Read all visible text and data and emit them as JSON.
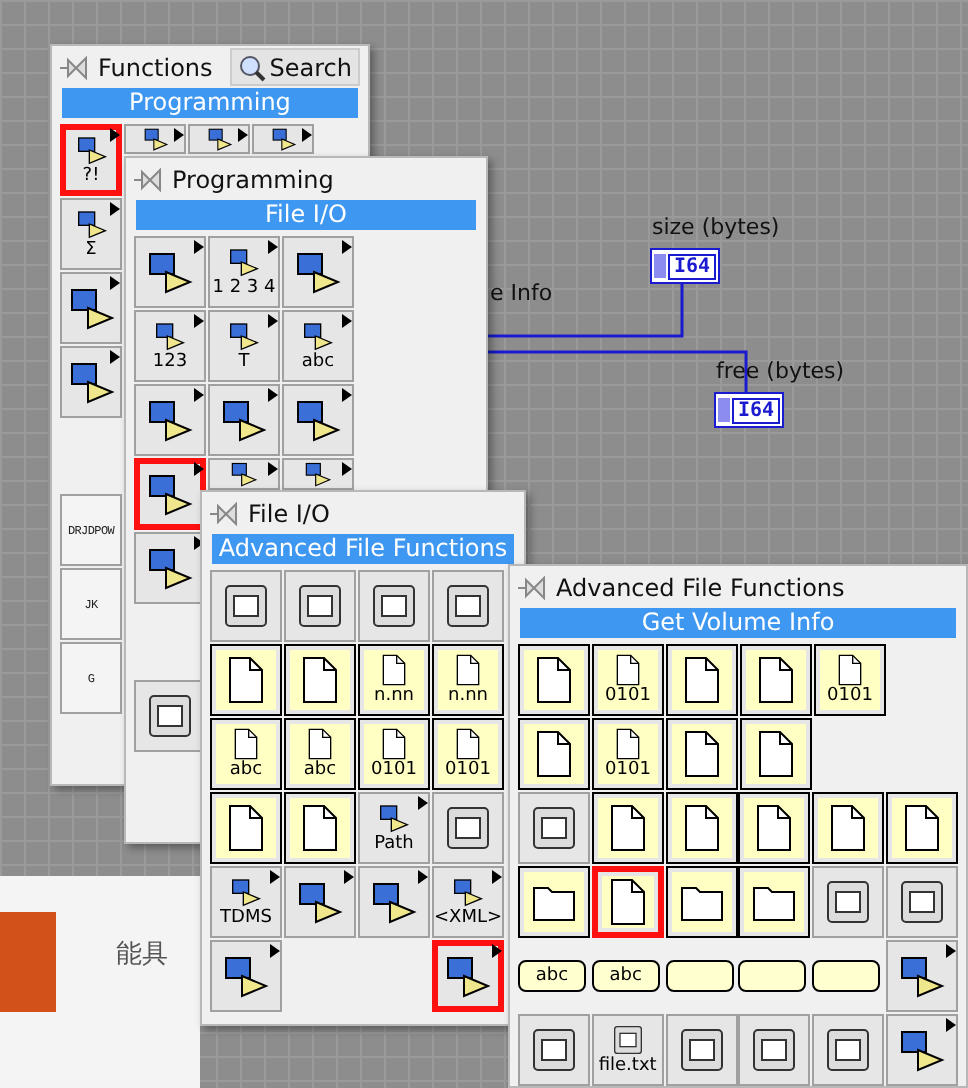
{
  "diagram": {
    "node_label": "e Info",
    "indicators": [
      {
        "label": "size (bytes)",
        "type": "I64"
      },
      {
        "label": "free (bytes)",
        "type": "I64"
      }
    ]
  },
  "page_text": "能具",
  "palettes": [
    {
      "title": "Functions",
      "search": "Search",
      "header": "Programming",
      "rows": [
        [
          {
            "kind": "palette",
            "label": "?!",
            "highlighted": true
          },
          {
            "kind": "palette",
            "highlighted": false
          },
          {
            "kind": "palette",
            "highlighted": false
          },
          {
            "kind": "palette",
            "highlighted": false
          }
        ],
        [
          {
            "kind": "palette",
            "label": "Σ",
            "highlighted": false
          }
        ],
        [
          {
            "kind": "palette",
            "highlighted": false
          }
        ],
        [
          {
            "kind": "palette",
            "highlighted": false
          }
        ],
        [
          {
            "kind": "empty"
          }
        ],
        [
          {
            "kind": "text",
            "label": "DRJDPOW",
            "highlighted": false
          }
        ],
        [
          {
            "kind": "text",
            "label": "JK",
            "highlighted": false
          }
        ],
        [
          {
            "kind": "text",
            "label": "G",
            "highlighted": false
          }
        ]
      ]
    },
    {
      "title": "Programming",
      "header": "File I/O",
      "rows": [
        [
          {
            "kind": "palette",
            "highlighted": false
          },
          {
            "kind": "palette",
            "label": "1 2 3 4",
            "highlighted": false
          },
          {
            "kind": "palette",
            "highlighted": false
          }
        ],
        [
          {
            "kind": "palette",
            "label": "123",
            "highlighted": false
          },
          {
            "kind": "palette",
            "label": "T",
            "highlighted": false
          },
          {
            "kind": "palette",
            "label": "abc",
            "highlighted": false
          }
        ],
        [
          {
            "kind": "palette",
            "highlighted": false
          },
          {
            "kind": "palette",
            "highlighted": false
          },
          {
            "kind": "palette",
            "highlighted": false
          }
        ],
        [
          {
            "kind": "palette",
            "highlighted": true
          },
          {
            "kind": "palette",
            "highlighted": false
          },
          {
            "kind": "palette",
            "highlighted": false
          }
        ],
        [
          {
            "kind": "palette",
            "highlighted": false
          }
        ],
        [
          {
            "kind": "empty"
          }
        ],
        [
          {
            "kind": "tool",
            "highlighted": false
          }
        ]
      ]
    },
    {
      "title": "File I/O",
      "header": "Advanced File Functions",
      "rows": [
        [
          {
            "kind": "tool",
            "highlighted": false
          },
          {
            "kind": "tool",
            "highlighted": false
          },
          {
            "kind": "tool",
            "highlighted": false
          },
          {
            "kind": "tool",
            "highlighted": false
          }
        ],
        [
          {
            "kind": "doc",
            "highlighted": false
          },
          {
            "kind": "doc",
            "highlighted": false
          },
          {
            "kind": "doc",
            "label": "n.nn",
            "highlighted": false
          },
          {
            "kind": "doc",
            "label": "n.nn",
            "highlighted": false
          }
        ],
        [
          {
            "kind": "doc",
            "label": "abc",
            "highlighted": false
          },
          {
            "kind": "doc",
            "label": "abc",
            "highlighted": false
          },
          {
            "kind": "doc",
            "label": "0101",
            "highlighted": false
          },
          {
            "kind": "doc",
            "label": "0101",
            "highlighted": false
          }
        ],
        [
          {
            "kind": "doc",
            "highlighted": false
          },
          {
            "kind": "doc",
            "highlighted": false
          },
          {
            "kind": "palette",
            "label": "Path",
            "highlighted": false
          },
          {
            "kind": "tool",
            "highlighted": false
          }
        ],
        [
          {
            "kind": "palette",
            "label": "TDMS",
            "highlighted": false
          },
          {
            "kind": "palette",
            "highlighted": false
          },
          {
            "kind": "palette",
            "highlighted": false
          },
          {
            "kind": "palette",
            "label": "<XML>",
            "highlighted": false
          }
        ],
        [
          {
            "kind": "palette",
            "highlighted": false
          },
          {
            "kind": "empty"
          },
          {
            "kind": "empty"
          },
          {
            "kind": "palette",
            "highlighted": true
          }
        ]
      ]
    },
    {
      "title": "Advanced File Functions",
      "header": "Get Volume Info",
      "rows": [
        [
          {
            "kind": "doc",
            "highlighted": false
          },
          {
            "kind": "doc",
            "label": "0101",
            "highlighted": false
          },
          {
            "kind": "doc",
            "highlighted": false
          },
          {
            "kind": "doc",
            "highlighted": false
          },
          {
            "kind": "doc",
            "label": "0101",
            "highlighted": false
          }
        ],
        [
          {
            "kind": "doc",
            "highlighted": false
          },
          {
            "kind": "doc",
            "label": "0101",
            "highlighted": false
          },
          {
            "kind": "doc",
            "highlighted": false
          },
          {
            "kind": "doc",
            "highlighted": false
          }
        ],
        [
          {
            "kind": "tool",
            "highlighted": false
          },
          {
            "kind": "doc",
            "highlighted": false
          },
          {
            "kind": "doc",
            "highlighted": false
          },
          {
            "kind": "doc",
            "highlighted": false
          },
          {
            "kind": "doc",
            "highlighted": false
          },
          {
            "kind": "doc",
            "highlighted": false
          }
        ],
        [
          {
            "kind": "folder",
            "highlighted": false
          },
          {
            "kind": "doc",
            "highlighted": true
          },
          {
            "kind": "folder",
            "highlighted": false
          },
          {
            "kind": "folder",
            "highlighted": false
          },
          {
            "kind": "tool",
            "highlighted": false
          },
          {
            "kind": "tool",
            "highlighted": false
          }
        ],
        [
          {
            "kind": "connector",
            "label": "abc",
            "highlighted": false
          },
          {
            "kind": "connector",
            "label": "abc",
            "highlighted": false
          },
          {
            "kind": "connector",
            "highlighted": false
          },
          {
            "kind": "connector",
            "highlighted": false
          },
          {
            "kind": "connector",
            "highlighted": false
          },
          {
            "kind": "palette",
            "highlighted": false
          }
        ],
        [
          {
            "kind": "tool",
            "highlighted": false
          },
          {
            "kind": "tool",
            "label": "file.txt",
            "highlighted": false
          },
          {
            "kind": "tool",
            "highlighted": false
          },
          {
            "kind": "tool",
            "highlighted": false
          },
          {
            "kind": "tool",
            "highlighted": false
          },
          {
            "kind": "palette",
            "highlighted": false
          }
        ]
      ]
    }
  ]
}
